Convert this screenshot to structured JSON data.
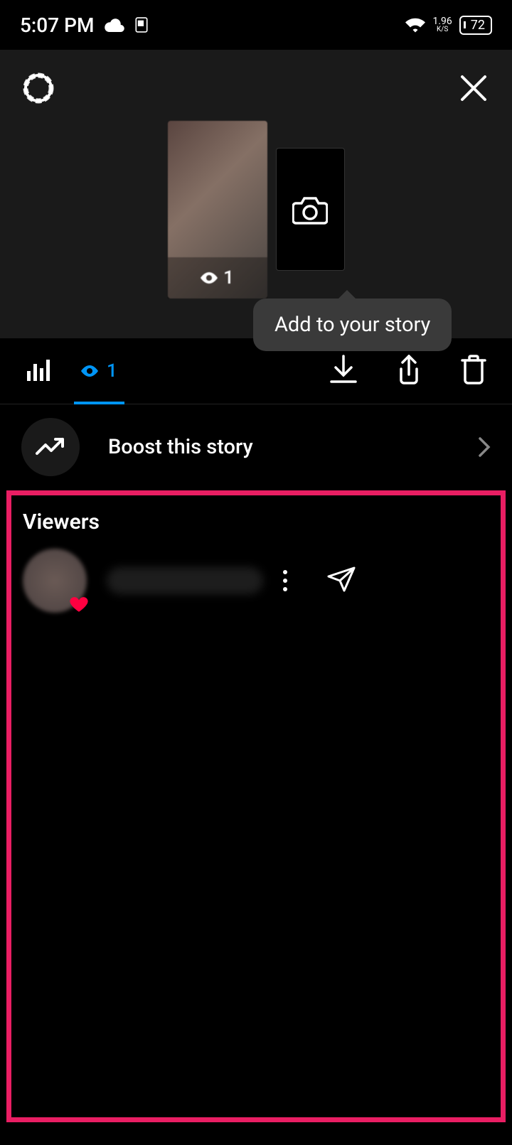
{
  "statusbar": {
    "time": "5:07 PM",
    "net_speed": "1.96",
    "net_unit": "K/S",
    "battery": "72"
  },
  "header": {
    "story_view_count": "1",
    "tooltip": "Add to your story"
  },
  "toolbar": {
    "viewers_count": "1"
  },
  "boost": {
    "label": "Boost this story"
  },
  "viewers": {
    "title": "Viewers",
    "items": [
      {
        "name": ""
      }
    ]
  }
}
